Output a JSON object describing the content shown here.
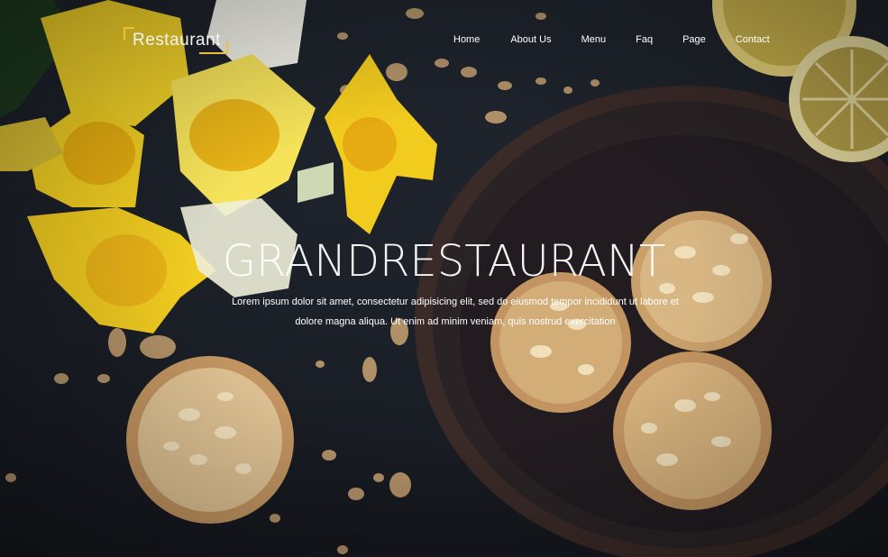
{
  "header": {
    "logo_text": "Restaurant",
    "nav": [
      {
        "label": "Home"
      },
      {
        "label": "About Us"
      },
      {
        "label": "Menu"
      },
      {
        "label": "Faq"
      },
      {
        "label": "Page"
      },
      {
        "label": "Contact"
      }
    ]
  },
  "hero": {
    "title": "GRANDRESTAURANT",
    "description": "Lorem ipsum dolor sit amet, consectetur adipisicing elit, sed do eiusmod tempor incididunt ut labore et dolore magna aliqua. Ut enim ad minim veniam, quis nostrud exercitation"
  },
  "colors": {
    "accent": "#e8c23a",
    "background": "#1b1f26",
    "text": "#ffffff"
  }
}
